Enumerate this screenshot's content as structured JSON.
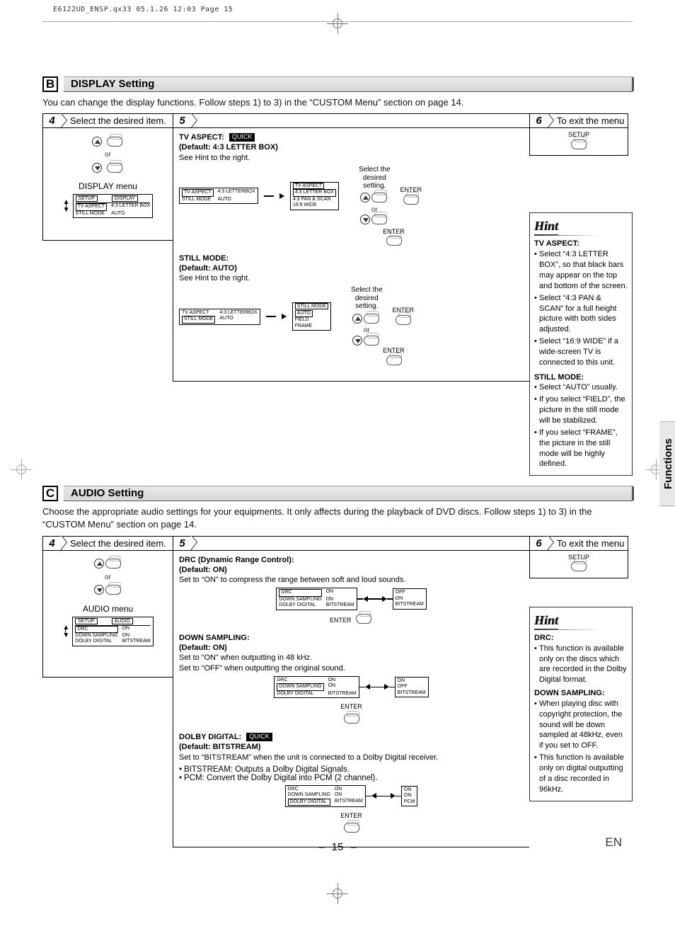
{
  "meta": {
    "print_header": "E6122UD_ENSP.qx33  05.1.26 12:03  Page 15",
    "page_number": "15",
    "language": "EN",
    "side_tab": "Functions"
  },
  "common": {
    "step4_label": "Select the desired item.",
    "step6_label": "To exit the menu",
    "or": "or",
    "enter": "ENTER",
    "setup": "SETUP",
    "quick_badge": "QUICK",
    "select_desired_setting": "Select the\ndesired\nsetting."
  },
  "display": {
    "letter": "B",
    "title": "DISPLAY Setting",
    "intro": "You can change the display functions. Follow steps 1) to 3) in the “CUSTOM Menu” section on page 14.",
    "step4_menu_title": "DISPLAY menu",
    "step4_tabs": {
      "setup": "SETUP",
      "display": "DISPLAY"
    },
    "step4_menu": {
      "r1a": "TV ASPECT",
      "r1b": "4:3 LETTER BOX",
      "r2a": "STILL MODE",
      "r2b": "AUTO"
    },
    "tv_aspect": {
      "title": "TV ASPECT:",
      "default": "(Default: 4:3 LETTER BOX)",
      "see_hint": "See Hint to the right.",
      "mini_menu": {
        "r1a": "TV ASPECT",
        "r1b": "4:3 LETTERBOX",
        "r2a": "STILL MODE",
        "r2b": "AUTO"
      },
      "options": {
        "head": "TV ASPECT",
        "o1": "4:3 LETTER BOX",
        "o2": "4:3 PAN & SCAN",
        "o3": "16:9 WIDE"
      }
    },
    "still_mode": {
      "title": "STILL MODE:",
      "default": "(Default: AUTO)",
      "see_hint": "See Hint to the right.",
      "mini_menu": {
        "r1a": "TV ASPECT",
        "r1b": "4:3 LETTERBOX",
        "r2a": "STILL MODE",
        "r2b": "AUTO"
      },
      "options": {
        "head": "STILL MODE",
        "o1": "AUTO",
        "o2": "FIELD",
        "o3": "FRAME"
      }
    },
    "hint": {
      "title": "Hint",
      "h1": "TV ASPECT:",
      "b1": "Select “4:3 LETTER BOX”, so that black bars may appear on the top and bottom of the screen.",
      "b2": "Select “4:3 PAN & SCAN” for a full height picture with both sides adjusted.",
      "b3": "Select “16:9 WIDE” if a wide-screen TV is connected to this unit.",
      "h2": "STILL MODE:",
      "b4": "Select “AUTO” usually.",
      "b5": "If you select “FIELD”, the picture in the still mode will be stabilized.",
      "b6": "If you select “FRAME”, the picture in the still mode will be highly defined."
    }
  },
  "audio": {
    "letter": "C",
    "title": "AUDIO Setting",
    "intro": "Choose the appropriate audio settings for your equipments. It only affects during the playback of DVD discs. Follow steps 1) to 3) in the “CUSTOM Menu” section on page 14.",
    "step4_menu_title": "AUDIO menu",
    "step4_tabs": {
      "setup": "SETUP",
      "audio": "AUDIO"
    },
    "step4_menu": {
      "r1a": "DRC",
      "r1b": "ON",
      "r2a": "DOWN SAMPLING",
      "r2b": "ON",
      "r3a": "DOLBY DIGITAL",
      "r3b": "BITSTREAM"
    },
    "drc": {
      "title": "DRC (Dynamic Range Control):",
      "default": "(Default: ON)",
      "desc": "Set to “ON” to compress the range between soft and loud sounds.",
      "menu": {
        "r1a": "DRC",
        "r1b": "ON",
        "r1c": "OFF",
        "r2a": "DOWN SAMPLING",
        "r2b": "ON",
        "r2c": "ON",
        "r3a": "DOLBY DIGITAL",
        "r3b": "BITSTREAM",
        "r3c": "BITSTREAM"
      }
    },
    "down": {
      "title": "DOWN SAMPLING:",
      "default": "(Default: ON)",
      "desc1": "Set to “ON” when outputting in 48 kHz.",
      "desc2": "Set to “OFF” when outputting the original sound.",
      "menu": {
        "r1a": "DRC",
        "r1b": "ON",
        "r1c": "ON",
        "r2a": "DOWN SAMPLING",
        "r2b": "ON",
        "r2c": "OFF",
        "r3a": "DOLBY DIGITAL",
        "r3b": "BITSTREAM",
        "r3c": "BITSTREAM"
      }
    },
    "dolby": {
      "title": "DOLBY DIGITAL:",
      "default": "(Default: BITSTREAM)",
      "desc": "Set to “BITSTREAM” when the unit is connected to a Dolby Digital receiver.",
      "b1": "BITSTREAM: Outputs a Dolby Digital Signals.",
      "b2": "PCM: Convert the Dolby Digital into PCM (2 channel).",
      "menu": {
        "r1a": "DRC",
        "r1b": "ON",
        "r1c": "ON",
        "r2a": "DOWN SAMPLING",
        "r2b": "ON",
        "r2c": "ON",
        "r3a": "DOLBY DIGITAL",
        "r3b": "BITSTREAM",
        "r3c": "PCM"
      }
    },
    "hint": {
      "title": "Hint",
      "h1": "DRC:",
      "b1": "This function is available only on the discs which are recorded in the Dolby Digital format.",
      "h2": "DOWN SAMPLING:",
      "b2": "When playing disc with copyright protection, the sound will be down sampled at 48kHz, even if you set to OFF.",
      "b3": "This function is available only on digital outputting of a disc recorded in 96kHz."
    }
  }
}
